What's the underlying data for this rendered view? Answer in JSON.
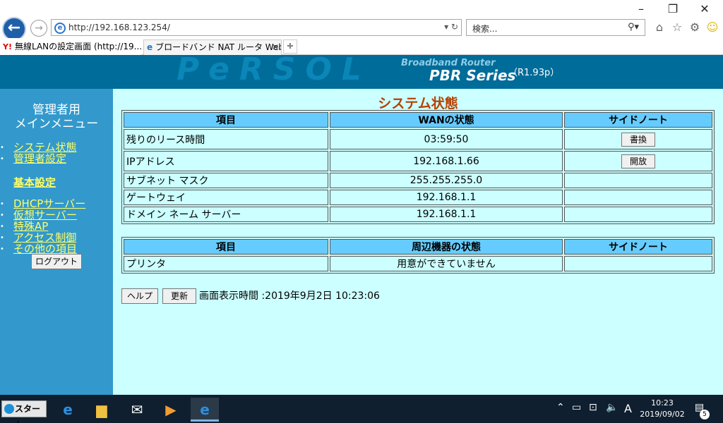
{
  "browser": {
    "address": "http://192.168.123.254/",
    "search_placeholder": "検索...",
    "tabs": [
      {
        "icon": "Y!",
        "label": "無線LANの設定画面 (http://19..."
      },
      {
        "label": "ブロードバンド NAT ルータ Web ..."
      }
    ]
  },
  "banner": {
    "logo": "PeRSOL",
    "subtitle": "Broadband Router",
    "series": "PBR Series",
    "version": "（R1.93p）"
  },
  "sidebar": {
    "title_line1": "管理者用",
    "title_line2": "メインメニュー",
    "group1": [
      "システム状態",
      "管理者設定"
    ],
    "basic_heading": "基本設定",
    "group2": [
      "DHCPサーバー",
      "仮想サーバー",
      "特殊AP",
      "アクセス制御",
      "その他の項目"
    ],
    "logout_label": "ログアウト"
  },
  "main": {
    "title": "システム状態",
    "wan_table": {
      "headers": [
        "項目",
        "WANの状態",
        "サイドノート"
      ],
      "rows": [
        {
          "item": "残りのリース時間",
          "value": "03:59:50",
          "action": "書換"
        },
        {
          "item": "IPアドレス",
          "value": "192.168.1.66",
          "action": "開放"
        },
        {
          "item": "サブネット マスク",
          "value": "255.255.255.0",
          "action": ""
        },
        {
          "item": "ゲートウェイ",
          "value": "192.168.1.1",
          "action": ""
        },
        {
          "item": "ドメイン ネーム サーバー",
          "value": "192.168.1.1",
          "action": ""
        }
      ]
    },
    "device_table": {
      "headers": [
        "項目",
        "周辺機器の状態",
        "サイドノート"
      ],
      "rows": [
        {
          "item": "プリンタ",
          "value": "用意ができていません",
          "note": ""
        }
      ]
    },
    "help_label": "ヘルプ",
    "refresh_label": "更新",
    "display_time": "画面表示時間 :2019年9月2日 10:23:06"
  },
  "taskbar": {
    "start_label": "スタート",
    "ime": "A",
    "time": "10:23",
    "date": "2019/09/02",
    "notification_count": "5"
  }
}
